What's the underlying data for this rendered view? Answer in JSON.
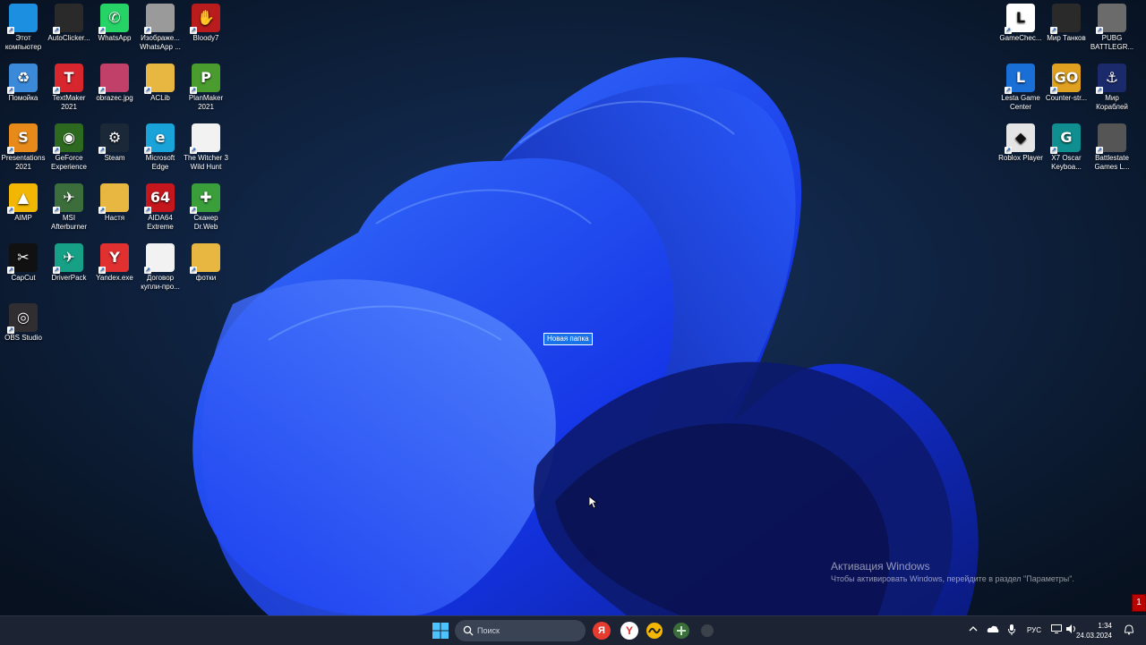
{
  "desktop": {
    "left_icons": [
      {
        "label": "Этот компьютер",
        "glyph": "",
        "color": "#1d8fe0",
        "icon": "monitor-icon"
      },
      {
        "label": "AutoClicker...",
        "glyph": "",
        "color": "#2a2a2a",
        "icon": "mouse-icon"
      },
      {
        "label": "WhatsApp",
        "glyph": "✆",
        "color": "#25d366",
        "icon": "whatsapp-icon"
      },
      {
        "label": "Изображе... WhatsApp ...",
        "glyph": "",
        "color": "#9a9a9a",
        "icon": "image-file-icon"
      },
      {
        "label": "Bloody7",
        "glyph": "✋",
        "color": "#b81c1c",
        "icon": "bloody-icon"
      },
      {
        "label": "Помойка",
        "glyph": "♻",
        "color": "#3b8ad9",
        "icon": "recycle-bin-icon"
      },
      {
        "label": "TextMaker 2021",
        "glyph": "T",
        "color": "#d8262e",
        "icon": "textmaker-icon"
      },
      {
        "label": "obrazec.jpg",
        "glyph": "",
        "color": "#c0406a",
        "icon": "jpg-file-icon"
      },
      {
        "label": "ACLib",
        "glyph": "",
        "color": "#e8b742",
        "icon": "folder-icon"
      },
      {
        "label": "PlanMaker 2021",
        "glyph": "P",
        "color": "#4a9c2e",
        "icon": "planmaker-icon"
      },
      {
        "label": "Presentations 2021",
        "glyph": "S",
        "color": "#e88a1a",
        "icon": "presentations-icon"
      },
      {
        "label": "GeForce Experience",
        "glyph": "◉",
        "color": "#2d6a1f",
        "icon": "geforce-icon"
      },
      {
        "label": "Steam",
        "glyph": "⚙",
        "color": "#1b2838",
        "icon": "steam-icon"
      },
      {
        "label": "Microsoft Edge",
        "glyph": "e",
        "color": "#1aa3d9",
        "icon": "edge-icon"
      },
      {
        "label": "The Witcher 3 Wild Hunt",
        "glyph": "",
        "color": "#f2f2f2",
        "icon": "document-icon"
      },
      {
        "label": "AIMP",
        "glyph": "▲",
        "color": "#f2b705",
        "icon": "aimp-icon"
      },
      {
        "label": "MSI Afterburner",
        "glyph": "✈",
        "color": "#3c6e3c",
        "icon": "afterburner-icon"
      },
      {
        "label": "Настя",
        "glyph": "",
        "color": "#e8b742",
        "icon": "folder-icon"
      },
      {
        "label": "AIDA64 Extreme",
        "glyph": "64",
        "color": "#c4161c",
        "icon": "aida64-icon"
      },
      {
        "label": "Сканер Dr.Web",
        "glyph": "✚",
        "color": "#3a9e3a",
        "icon": "drweb-icon"
      },
      {
        "label": "CapCut",
        "glyph": "✂",
        "color": "#111111",
        "icon": "capcut-icon"
      },
      {
        "label": "DriverPack",
        "glyph": "✈",
        "color": "#16a085",
        "icon": "driverpack-icon"
      },
      {
        "label": "Yandex.exe",
        "glyph": "Y",
        "color": "#e03030",
        "icon": "yandex-icon"
      },
      {
        "label": "Договор купли-про...",
        "glyph": "",
        "color": "#f2f2f2",
        "icon": "document-icon"
      },
      {
        "label": "фотки",
        "glyph": "",
        "color": "#e8b742",
        "icon": "folder-icon"
      },
      {
        "label": "OBS Studio",
        "glyph": "◎",
        "color": "#302e31",
        "icon": "obs-icon"
      }
    ],
    "right_icons": [
      {
        "label": "GameChec...",
        "glyph": "L",
        "color": "#ffffff",
        "icon": "gamecheck-icon"
      },
      {
        "label": "Мир Танков",
        "glyph": "",
        "color": "#2a2a2a",
        "icon": "tanks-icon"
      },
      {
        "label": "PUBG BATTLEGR...",
        "glyph": "",
        "color": "#6b6b6b",
        "icon": "pubg-icon"
      },
      {
        "label": "Lesta Game Center",
        "glyph": "L",
        "color": "#1a6fd6",
        "icon": "lesta-icon"
      },
      {
        "label": "Counter-str...",
        "glyph": "GO",
        "color": "#e0a020",
        "icon": "csgo-icon"
      },
      {
        "label": "Мир Кораблей",
        "glyph": "⚓",
        "color": "#1a2a6b",
        "icon": "ships-icon"
      },
      {
        "label": "Roblox Player",
        "glyph": "◆",
        "color": "#e5e5e5",
        "icon": "roblox-icon"
      },
      {
        "label": "X7 Oscar Keyboa...",
        "glyph": "G",
        "color": "#0f8f8f",
        "icon": "keyboard-icon"
      },
      {
        "label": "Battlestate Games L...",
        "glyph": "",
        "color": "#555555",
        "icon": "battlestate-icon"
      }
    ],
    "new_folder_label": "Новая папка"
  },
  "activation": {
    "title": "Активация Windows",
    "subtitle": "Чтобы активировать Windows, перейдите в раздел \"Параметры\"."
  },
  "taskbar": {
    "search_placeholder": "Поиск",
    "language": "РУС",
    "time": "1:34",
    "date": "24.03.2024",
    "pinned": [
      {
        "icon": "start-icon",
        "color": "#3ba0ff"
      },
      {
        "icon": "yandex-browser-icon",
        "color": "#e63b2e"
      },
      {
        "icon": "yandex-icon",
        "color": "#ffffff"
      },
      {
        "icon": "aimp-icon",
        "color": "#f2b705"
      },
      {
        "icon": "afterburner-icon",
        "color": "#3c6e3c"
      }
    ]
  },
  "colors": {
    "accent": "#1a73e8",
    "wallpaper_dark": "#0a1526",
    "wallpaper_blue": "#1f4fff",
    "taskbar": "#1c2433"
  }
}
